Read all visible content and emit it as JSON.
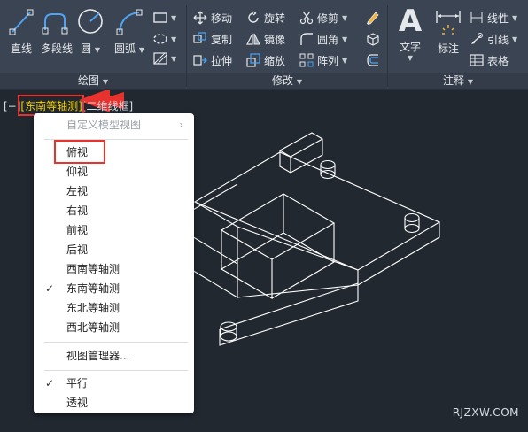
{
  "ribbon": {
    "draw": {
      "line": "直线",
      "polyline": "多段线",
      "circle": "圆",
      "arc": "圆弧",
      "panel_label": "绘图"
    },
    "modify": {
      "move": "移动",
      "rotate": "旋转",
      "trim": "修剪",
      "copy": "复制",
      "mirror": "镜像",
      "fillet": "圆角",
      "stretch": "拉伸",
      "scale": "缩放",
      "array": "阵列",
      "panel_label": "修改"
    },
    "annotation": {
      "text": "文字",
      "dimension": "标注",
      "linear": "线性",
      "leader": "引线",
      "table": "表格",
      "panel_label": "注释"
    }
  },
  "viewport": {
    "bracket_minus": "[−]",
    "view_name": "[东南等轴测]",
    "visual_style": "[二维线框]"
  },
  "menu": {
    "custom_views": "自定义模型视图",
    "items": [
      "俯视",
      "仰视",
      "左视",
      "右视",
      "前视",
      "后视",
      "西南等轴测",
      "东南等轴测",
      "东北等轴测",
      "西北等轴测"
    ],
    "checked_view": "东南等轴测",
    "view_manager": "视图管理器...",
    "parallel": "平行",
    "perspective": "透视"
  },
  "watermark": "RJZXW.COM",
  "colors": {
    "ribbon_bg": "#3b4453",
    "canvas_bg": "#212830",
    "highlight_text": "#f5d000",
    "annotation_red": "#e8322e"
  }
}
